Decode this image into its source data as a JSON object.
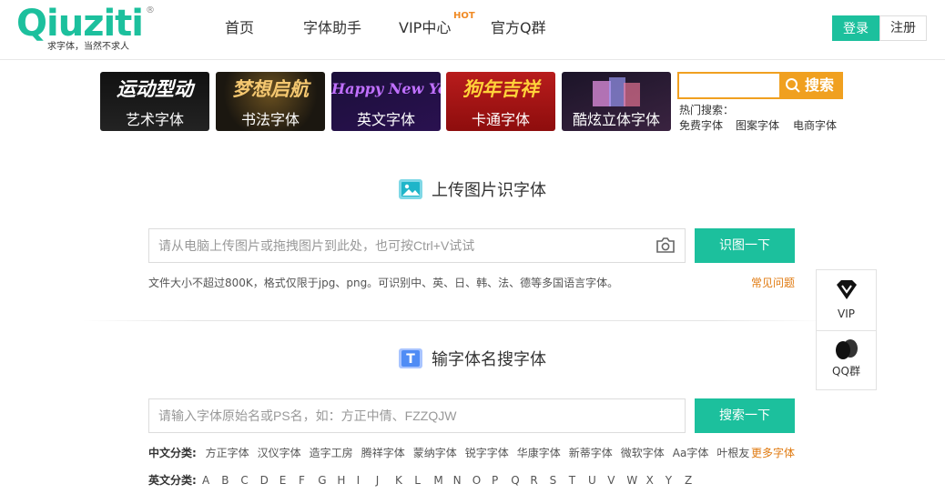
{
  "header": {
    "logo": {
      "text": "Qiuziti",
      "reg": "®",
      "slogan": "求字体，当然不求人"
    },
    "nav": [
      {
        "label": "首页"
      },
      {
        "label": "字体助手"
      },
      {
        "label": "VIP中心"
      },
      {
        "label": "官方Q群"
      }
    ],
    "hot_badge": "HOT",
    "login_label": "登录",
    "register_label": "注册"
  },
  "banners": [
    {
      "art": "运动型动",
      "caption": "艺术字体",
      "art_color": "#ffffff"
    },
    {
      "art": "梦想启航",
      "caption": "书法字体",
      "art_color": "#f4c770"
    },
    {
      "art": "Happy New Year",
      "caption": "英文字体",
      "art_color": "#c070ff"
    },
    {
      "art": "狗年吉祥",
      "caption": "卡通字体",
      "art_color": "#ffd23a"
    },
    {
      "art": "",
      "caption": "酷炫立体字体",
      "art_color": "#e0a0ff"
    }
  ],
  "top_search": {
    "placeholder": "",
    "button_label": "搜索",
    "hot_label": "热门搜索：",
    "hot_links": [
      "免费字体",
      "图案字体",
      "电商字体"
    ]
  },
  "upload_section": {
    "title": "上传图片识字体",
    "placeholder": "请从电脑上传图片或拖拽图片到此处，也可按Ctrl+V试试",
    "button_label": "识图一下",
    "note": "文件大小不超过800K，格式仅限于jpg、png。可识别中、英、日、韩、法、德等多国语言字体。",
    "faq_link": "常见问题"
  },
  "name_section": {
    "title": "输字体名搜字体",
    "placeholder": "请输入字体原始名或PS名，如：方正中倩、FZZQJW",
    "button_label": "搜索一下",
    "cn_label": "中文分类:",
    "cn_items": [
      "方正字体",
      "汉仪字体",
      "造字工房",
      "腾祥字体",
      "蒙纳字体",
      "锐字字体",
      "华康字体",
      "新蒂字体",
      "微软字体",
      "Aa字体",
      "叶根友"
    ],
    "more_link": "更多字体",
    "en_label": "英文分类:",
    "en_letters": [
      "A",
      "B",
      "C",
      "D",
      "E",
      "F",
      "G",
      "H",
      "I",
      "J",
      "K",
      "L",
      "M",
      "N",
      "O",
      "P",
      "Q",
      "R",
      "S",
      "T",
      "U",
      "V",
      "W",
      "X",
      "Y",
      "Z"
    ]
  },
  "side_panel": {
    "vip_label": "VIP",
    "qq_label": "QQ群"
  },
  "colors": {
    "brand": "#1cc09d",
    "accent": "#f0a020",
    "link_orange": "#e07a10"
  }
}
